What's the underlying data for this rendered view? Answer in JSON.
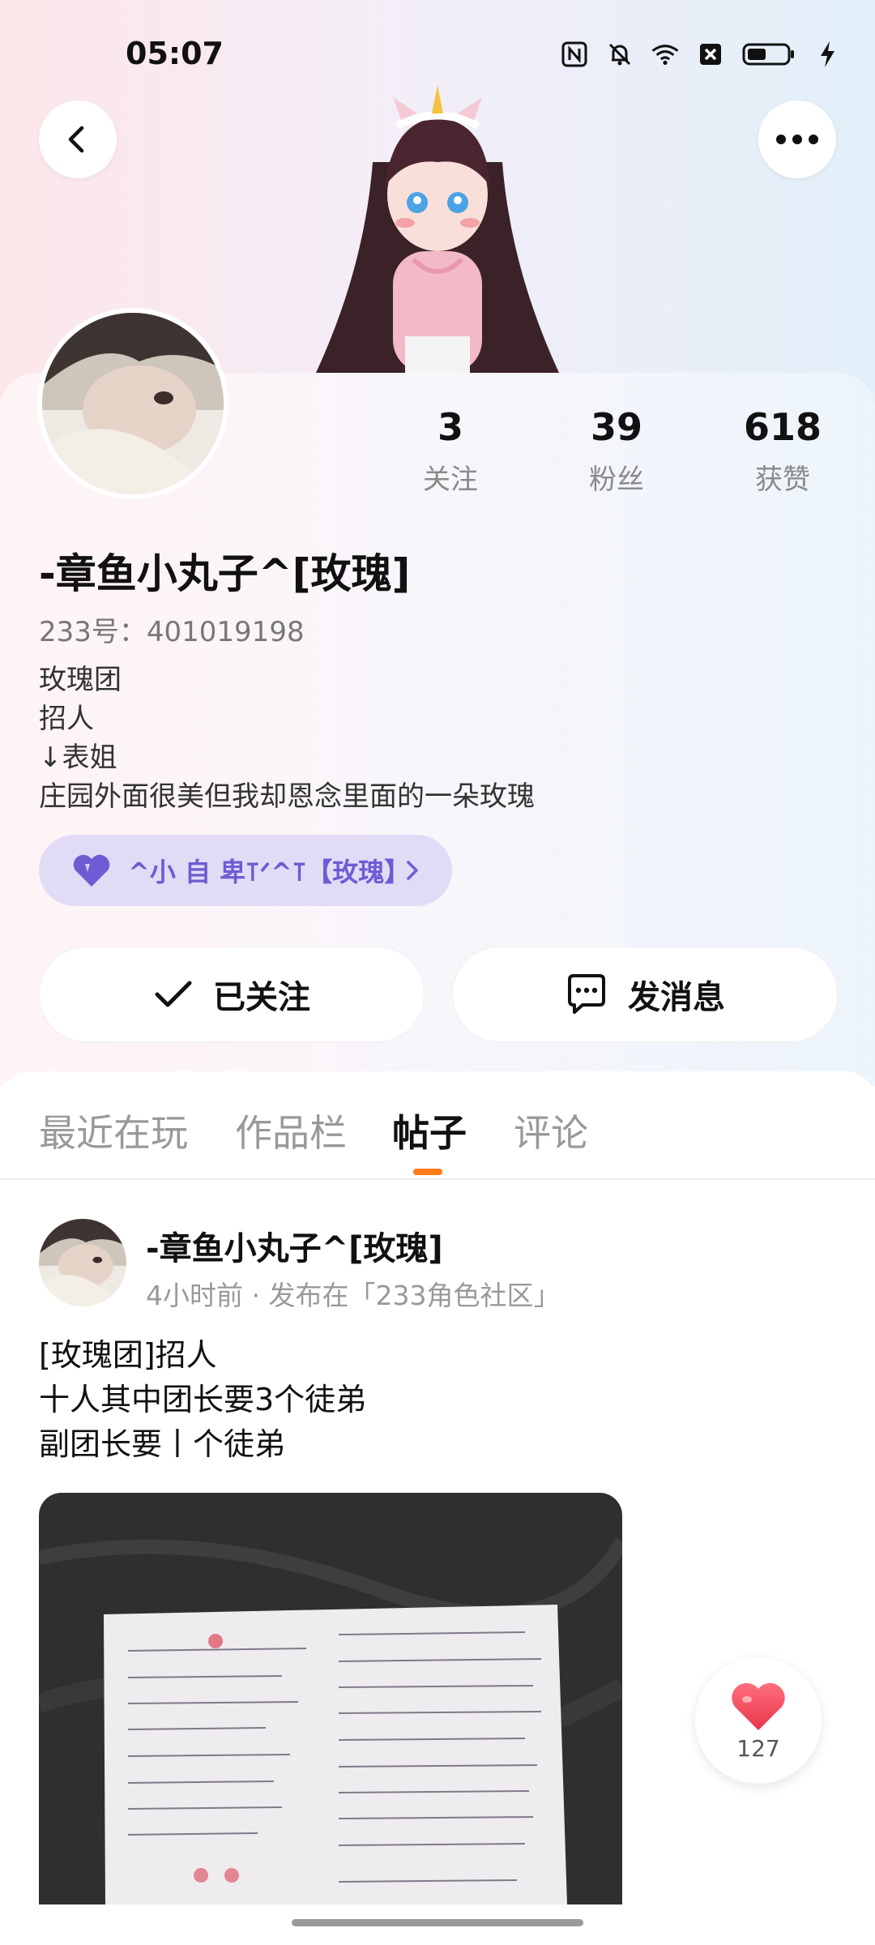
{
  "status_bar": {
    "time": "05:07"
  },
  "profile": {
    "stats": [
      {
        "value": "3",
        "label": "关注"
      },
      {
        "value": "39",
        "label": "粉丝"
      },
      {
        "value": "618",
        "label": "获赞"
      }
    ],
    "username": "-章鱼小丸子^[玫瑰]",
    "user_id": "233号：401019198",
    "bio_lines": [
      "玫瑰团",
      "招人",
      "↓表姐",
      "庄园外面很美但我却恩念里面的一朵玫瑰"
    ],
    "tag_label": "^小 自 卑⊺ᐟ^⊺【玫瑰】"
  },
  "actions": {
    "follow_label": "已关注",
    "message_label": "发消息"
  },
  "tabs": [
    {
      "label": "最近在玩"
    },
    {
      "label": "作品栏"
    },
    {
      "label": "帖子"
    },
    {
      "label": "评论"
    }
  ],
  "active_tab": "帖子",
  "post": {
    "author": "-章鱼小丸子^[玫瑰]",
    "meta": "4小时前 · 发布在「233角色社区」",
    "lines": [
      "[玫瑰团]招人",
      "十人其中团长要3个徒弟",
      "副团长要丨个徒弟"
    ],
    "like_count": "127"
  },
  "colors": {
    "accent": "#ff7a1a",
    "tag_text": "#6f5bd3",
    "tag_bg": "#e2dbf6",
    "like": "#f0455a"
  }
}
